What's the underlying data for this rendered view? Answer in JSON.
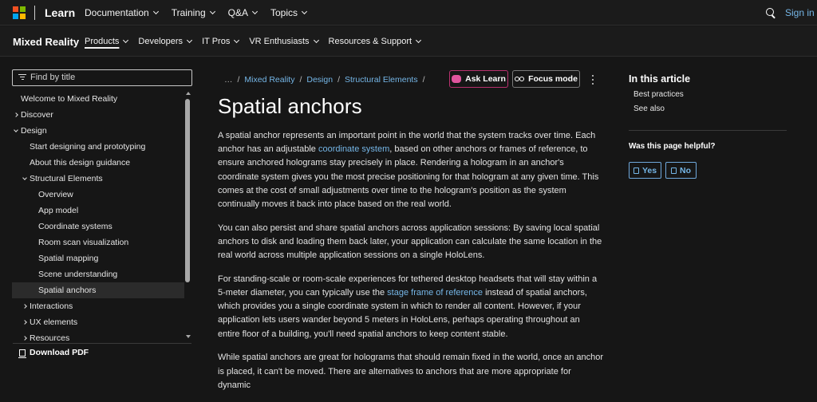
{
  "topbar": {
    "brand": "Learn",
    "nav": [
      "Documentation",
      "Training",
      "Q&A",
      "Topics"
    ],
    "signin": "Sign in",
    "logo_colors": [
      "#f25022",
      "#7fba00",
      "#00a4ef",
      "#ffb900"
    ]
  },
  "subbar": {
    "brand": "Mixed Reality",
    "nav": [
      "Products",
      "Developers",
      "IT Pros",
      "VR Enthusiasts",
      "Resources & Support"
    ]
  },
  "sidebar": {
    "filter_placeholder": "Find by title",
    "items": [
      {
        "label": "Welcome to Mixed Reality",
        "level": 0,
        "caret": "none"
      },
      {
        "label": "Discover",
        "level": 0,
        "caret": "right"
      },
      {
        "label": "Design",
        "level": 0,
        "caret": "down"
      },
      {
        "label": "Start designing and prototyping",
        "level": 1,
        "caret": "none"
      },
      {
        "label": "About this design guidance",
        "level": 1,
        "caret": "none"
      },
      {
        "label": "Structural Elements",
        "level": 1,
        "caret": "down"
      },
      {
        "label": "Overview",
        "level": 2,
        "caret": "none"
      },
      {
        "label": "App model",
        "level": 2,
        "caret": "none"
      },
      {
        "label": "Coordinate systems",
        "level": 2,
        "caret": "none"
      },
      {
        "label": "Room scan visualization",
        "level": 2,
        "caret": "none"
      },
      {
        "label": "Spatial mapping",
        "level": 2,
        "caret": "none"
      },
      {
        "label": "Scene understanding",
        "level": 2,
        "caret": "none"
      },
      {
        "label": "Spatial anchors",
        "level": 2,
        "caret": "none",
        "selected": true
      },
      {
        "label": "Interactions",
        "level": 1,
        "caret": "right"
      },
      {
        "label": "UX elements",
        "level": 1,
        "caret": "right"
      },
      {
        "label": "Resources",
        "level": 1,
        "caret": "right"
      }
    ],
    "download": "Download PDF"
  },
  "breadcrumb": {
    "more": "…",
    "items": [
      "Mixed Reality",
      "Design",
      "Structural Elements"
    ]
  },
  "actions": {
    "ask": "Ask Learn",
    "focus": "Focus mode",
    "ask_color": "#e0559e"
  },
  "article": {
    "title": "Spatial anchors",
    "p1_a": "A spatial anchor represents an important point in the world that the system tracks over time. Each anchor has an adjustable ",
    "p1_link": "coordinate system",
    "p1_b": ", based on other anchors or frames of reference, to ensure anchored holograms stay precisely in place. Rendering a hologram in an anchor's coordinate system gives you the most precise positioning for that hologram at any given time. This comes at the cost of small adjustments over time to the hologram's position as the system continually moves it back into place based on the real world.",
    "p2": "You can also persist and share spatial anchors across application sessions: By saving local spatial anchors to disk and loading them back later, your application can calculate the same location in the real world across multiple application sessions on a single HoloLens.",
    "p3_a": "For standing-scale or room-scale experiences for tethered desktop headsets that will stay within a 5-meter diameter, you can typically use the ",
    "p3_link": "stage frame of reference",
    "p3_b": " instead of spatial anchors, which provides you a single coordinate system in which to render all content. However, if your application lets users wander beyond 5 meters in HoloLens, perhaps operating throughout an entire floor of a building, you'll need spatial anchors to keep content stable.",
    "p4": "While spatial anchors are great for holograms that should remain fixed in the world, once an anchor is placed, it can't be moved. There are alternatives to anchors that are more appropriate for dynamic"
  },
  "rail": {
    "title": "In this article",
    "links": [
      "Best practices",
      "See also"
    ],
    "helpful": "Was this page helpful?",
    "yes": "Yes",
    "no": "No",
    "link_color": "#75b6e7"
  }
}
